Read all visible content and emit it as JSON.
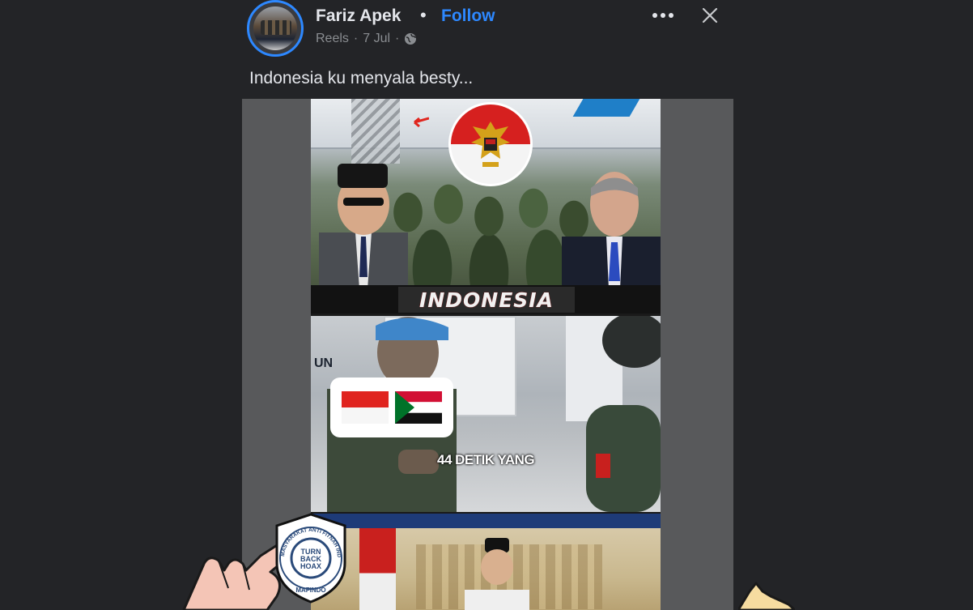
{
  "post": {
    "author": "Fariz Apek",
    "separator": "•",
    "follow_label": "Follow",
    "source": "Reels",
    "meta_sep_1": "·",
    "date": "7 Jul",
    "meta_sep_2": "·",
    "caption": "Indonesia ku menyala besty..."
  },
  "video": {
    "title_overlay": "INDONESIA",
    "truck_label": "UN",
    "subtitle_overlay": "44 DETIK YANG"
  },
  "badge": {
    "ring_text": "MASYARAKAT ANTI FITNAH INDONESIA",
    "center_line1": "TURN",
    "center_line2": "BACK",
    "center_line3": "HOAX",
    "bottom_text": "MAFINDO"
  },
  "colors": {
    "background": "#232427",
    "follow": "#2d88ff",
    "text": "#e4e6eb",
    "muted": "#8a8d91"
  },
  "icons": [
    "more-options-icon",
    "close-icon",
    "globe-icon",
    "garuda-emblem-icon",
    "indonesia-flag-icon",
    "sudan-flag-icon"
  ]
}
